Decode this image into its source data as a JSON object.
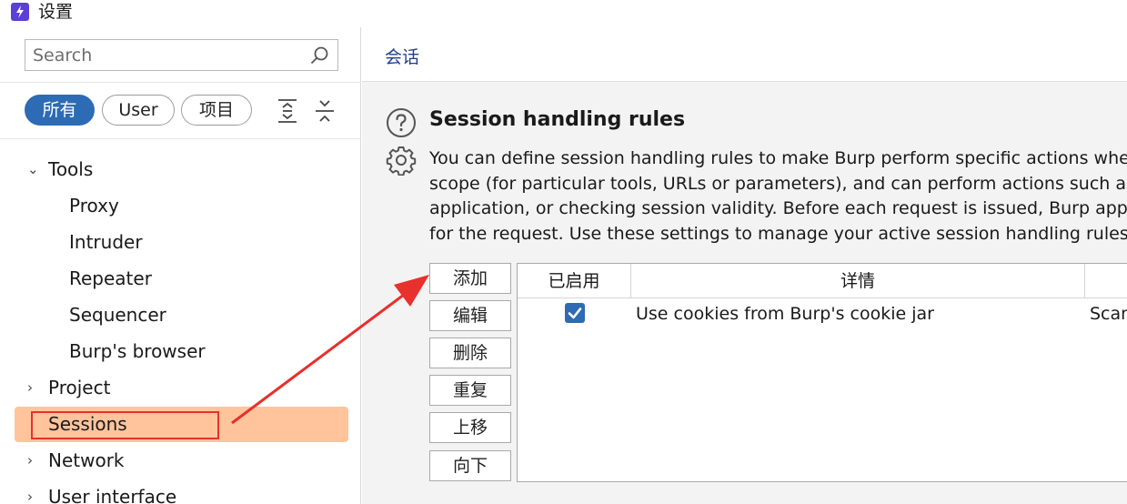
{
  "window": {
    "title": "设置"
  },
  "search": {
    "placeholder": "Search",
    "value": ""
  },
  "filters": [
    {
      "label": "所有",
      "active": true
    },
    {
      "label": "User",
      "active": false
    },
    {
      "label": "项目",
      "active": false
    }
  ],
  "tree": {
    "tools": "Tools",
    "proxy": "Proxy",
    "intruder": "Intruder",
    "repeater": "Repeater",
    "sequencer": "Sequencer",
    "burps_browser": "Burp's browser",
    "project": "Project",
    "sessions": "Sessions",
    "network": "Network",
    "user_interface": "User interface"
  },
  "main": {
    "header_title": "会话",
    "section_title": "Session handling rules",
    "description_lines": [
      "You can define session handling rules to make Burp perform specific actions whe",
      "scope (for particular tools, URLs or parameters), and can perform actions such as",
      "application, or checking session validity. Before each request is issued, Burp appl",
      "for the request. Use these settings to manage your active session handling rules."
    ]
  },
  "buttons": {
    "add": "添加",
    "edit": "编辑",
    "remove": "删除",
    "duplicate": "重复",
    "up": "上移",
    "down": "向下"
  },
  "table": {
    "headers": {
      "enabled": "已启用",
      "details": "详情"
    },
    "rows": [
      {
        "enabled": true,
        "details": "Use cookies from Burp's cookie jar",
        "scope": "Scan"
      }
    ]
  },
  "colors": {
    "accent": "#2d6bb4",
    "selected_bg": "#ffc49b",
    "annotation_red": "#e8302c"
  }
}
